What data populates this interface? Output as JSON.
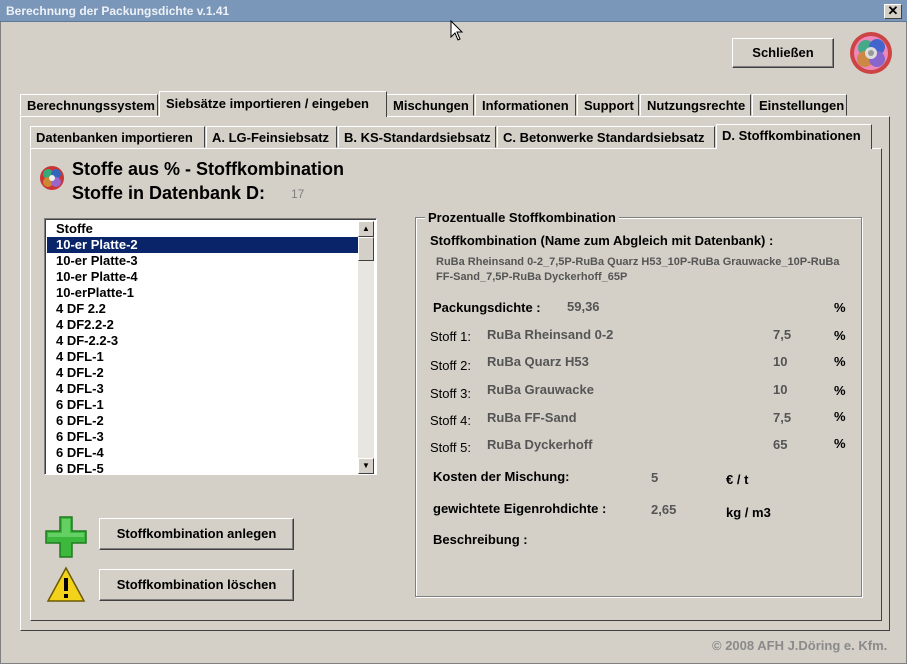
{
  "window": {
    "title": "Berechnung der Packungsdichte v.1.41",
    "close_glyph": "✕"
  },
  "buttons": {
    "close_label": "Schließen",
    "create_label": "Stoffkombination anlegen",
    "delete_label": "Stoffkombination löschen"
  },
  "tabs": [
    {
      "label": "Berechnungssystem"
    },
    {
      "label": "Siebsätze importieren / eingeben"
    },
    {
      "label": "Mischungen"
    },
    {
      "label": "Informationen"
    },
    {
      "label": "Support"
    },
    {
      "label": "Nutzungsrechte"
    },
    {
      "label": "Einstellungen"
    }
  ],
  "subtabs": [
    {
      "label": "Datenbanken importieren"
    },
    {
      "label": "A. LG-Feinsiebsatz"
    },
    {
      "label": "B. KS-Standardsiebsatz"
    },
    {
      "label": "C. Betonwerke Standardsiebsatz"
    },
    {
      "label": "D. Stoffkombinationen"
    }
  ],
  "heading": {
    "line1": "Stoffe aus % - Stoffkombination",
    "line2": "Stoffe in Datenbank D:",
    "count": "17"
  },
  "list": {
    "header": "Stoffe",
    "items": [
      "10-er Platte-2",
      "10-er Platte-3",
      "10-er Platte-4",
      "10-erPlatte-1",
      "4 DF 2.2",
      "4 DF2.2-2",
      "4 DF-2.2-3",
      "4 DFL-1",
      "4 DFL-2",
      "4 DFL-3",
      "6 DFL-1",
      "6 DFL-2",
      "6 DFL-3",
      "6 DFL-4",
      "6 DFL-5"
    ]
  },
  "group": {
    "legend": "Prozentualle Stoffkombination",
    "combo_label": "Stoffkombination (Name zum Abgleich mit Datenbank) :",
    "combo_name": "RuBa Rheinsand 0-2_7,5P-RuBa Quarz H53_10P-RuBa Grauwacke_10P-RuBa FF-Sand_7,5P-RuBa Dyckerhoff_65P",
    "packing_label": "Packungsdichte :",
    "packing_value": "59,36",
    "percent": "%",
    "stoffe": [
      {
        "label": "Stoff 1:",
        "name": "RuBa Rheinsand 0-2",
        "value": "7,5",
        "unit": "%"
      },
      {
        "label": "Stoff 2:",
        "name": "RuBa Quarz H53",
        "value": "10",
        "unit": "%"
      },
      {
        "label": "Stoff 3:",
        "name": "RuBa Grauwacke",
        "value": "10",
        "unit": "%"
      },
      {
        "label": "Stoff 4:",
        "name": "RuBa FF-Sand",
        "value": "7,5",
        "unit": "%"
      },
      {
        "label": "Stoff 5:",
        "name": "RuBa Dyckerhoff",
        "value": "65",
        "unit": "%"
      }
    ],
    "cost_label": "Kosten der Mischung:",
    "cost_value": "5",
    "cost_unit": "€ / t",
    "density_label": "gewichtete Eigenrohdichte :",
    "density_value": "2,65",
    "density_unit": "kg / m3",
    "desc_label": "Beschreibung :"
  },
  "footer": "© 2008  AFH J.Döring e. Kfm."
}
